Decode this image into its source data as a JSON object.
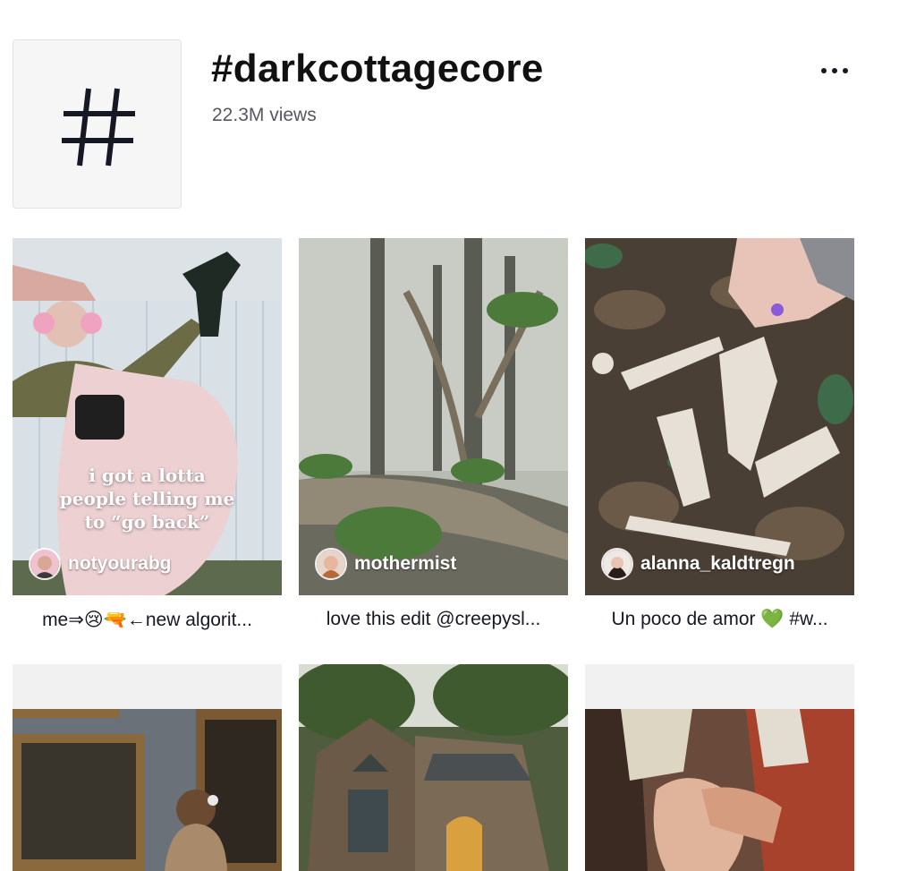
{
  "header": {
    "title": "#darkcottagecore",
    "views": "22.3M views",
    "more_icon": "more-horizontal-icon"
  },
  "videos": [
    {
      "author": "notyourabg",
      "overlay_lines": [
        "i got a lotta",
        "people telling me",
        "to “go back”"
      ],
      "caption": "me⇒😢🔫←new algorit..."
    },
    {
      "author": "mothermist",
      "caption": "love this edit @creepysl..."
    },
    {
      "author": "alanna_kaldtregn",
      "caption": "Un poco de amor 💚 #w..."
    },
    {
      "author": "",
      "caption": ""
    },
    {
      "author": "",
      "caption": ""
    },
    {
      "author": "",
      "caption": ""
    }
  ],
  "colors": {
    "text": "#161823",
    "muted": "#57585f",
    "tile_bg": "#f6f6f7"
  }
}
